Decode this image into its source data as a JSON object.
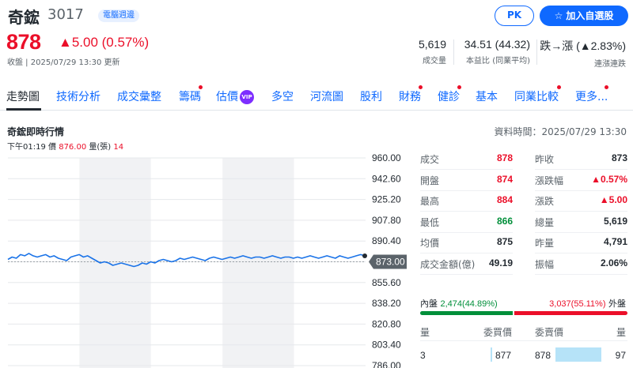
{
  "header": {
    "name": "奇鋐",
    "code": "3017",
    "badge": "電腦週邊",
    "pk_label": "PK",
    "watchlist_label": "加入自選股",
    "price": "878",
    "change": "▲5.00 (0.57%)",
    "status": "收盤 | 2025/07/29 13:30 更新",
    "stats": [
      {
        "value": "5,619",
        "label": "成交量"
      },
      {
        "value": "34.51 (44.32)",
        "label": "本益比 (同業平均)"
      },
      {
        "value": "跌→漲 (▲2.83%)",
        "label": "連漲連跌"
      }
    ]
  },
  "tabs": [
    "走勢圖",
    "技術分析",
    "成交彙整",
    "籌碼",
    "估價",
    "多空",
    "河流圖",
    "股利",
    "財務",
    "健診",
    "基本",
    "同業比較",
    "更多..."
  ],
  "vip_label": "VIP",
  "section": {
    "title": "奇鋐即時行情",
    "data_time": "資料時間：2025/07/29 13:30",
    "tick": {
      "time": "下午01:19",
      "price_label": "價",
      "price": "876.00",
      "vol_label": "量(張)",
      "vol": "14"
    }
  },
  "chart_data": {
    "type": "line",
    "y_ticks": [
      "960.00",
      "942.60",
      "925.20",
      "907.80",
      "890.40",
      "873.00",
      "855.60",
      "838.20",
      "820.80",
      "803.40",
      "786.00"
    ],
    "ylim": [
      786.0,
      960.0
    ],
    "reference_price": 873.0,
    "reference_label": "873.00",
    "series": [
      {
        "values": [
          875,
          877,
          876,
          879,
          878,
          880,
          878,
          877,
          878,
          879,
          877,
          878,
          876,
          875,
          874,
          877,
          878,
          879,
          877,
          878,
          876,
          874,
          872,
          873,
          872,
          870,
          871,
          872,
          871,
          870,
          869,
          870,
          872,
          871,
          873,
          872,
          874,
          875,
          874,
          873,
          874,
          876,
          875,
          876,
          877,
          876,
          875,
          874,
          876,
          877,
          876,
          875,
          876,
          877,
          876,
          877,
          878,
          877,
          876,
          877,
          877,
          876,
          877,
          878,
          877,
          876,
          877,
          877,
          876,
          877,
          876,
          877,
          878,
          877,
          876,
          877,
          878,
          877,
          876,
          878,
          877,
          876,
          877,
          878,
          879,
          878
        ]
      }
    ]
  },
  "quote": {
    "left": [
      {
        "label": "成交",
        "value": "878",
        "color": "up"
      },
      {
        "label": "開盤",
        "value": "874",
        "color": "up"
      },
      {
        "label": "最高",
        "value": "884",
        "color": "up"
      },
      {
        "label": "最低",
        "value": "866",
        "color": "down"
      },
      {
        "label": "均價",
        "value": "875",
        "color": "neutral"
      },
      {
        "label": "成交金額(億)",
        "value": "49.19",
        "color": "neutral"
      }
    ],
    "right": [
      {
        "label": "昨收",
        "value": "873",
        "color": "neutral"
      },
      {
        "label": "漲跌幅",
        "value": "▲0.57%",
        "color": "up"
      },
      {
        "label": "漲跌",
        "value": "▲5.00",
        "color": "up"
      },
      {
        "label": "總量",
        "value": "5,619",
        "color": "neutral"
      },
      {
        "label": "昨量",
        "value": "4,791",
        "color": "neutral"
      },
      {
        "label": "振幅",
        "value": "2.06%",
        "color": "neutral"
      }
    ]
  },
  "inout": {
    "in_label": "內盤",
    "in_value": "2,474(44.89%)",
    "in_ratio": 0.4489,
    "out_value": "3,037(55.11%)",
    "out_label": "外盤"
  },
  "orderbook": {
    "headers": [
      "量",
      "委買價",
      "委賣價",
      "量"
    ],
    "rows": [
      {
        "bid_vol": "3",
        "bid_price": "877",
        "ask_price": "878",
        "ask_vol": "97"
      }
    ]
  }
}
